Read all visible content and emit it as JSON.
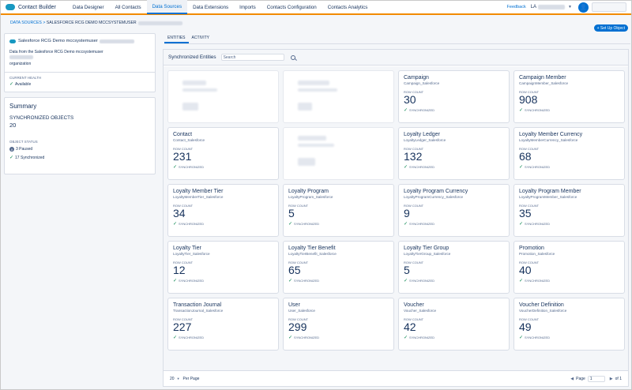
{
  "app": {
    "title": "Contact Builder",
    "brand_color": "#1798c1",
    "accent": "#f28b00"
  },
  "nav": [
    {
      "label": "Data Designer",
      "active": false
    },
    {
      "label": "All Contacts",
      "active": false
    },
    {
      "label": "Data Sources",
      "active": true
    },
    {
      "label": "Data Extensions",
      "active": false
    },
    {
      "label": "Imports",
      "active": false
    },
    {
      "label": "Contacts Configuration",
      "active": false
    },
    {
      "label": "Contacts Analytics",
      "active": false
    }
  ],
  "topright": {
    "feedback": "Feedback",
    "account": "LA",
    "caret": "▼",
    "avatar": "👤"
  },
  "breadcrumb": {
    "root": "DATA SOURCES",
    "sep": " > ",
    "current": "SALESFORCE RCG DEMO MCCSYSTEMUSER"
  },
  "setup_button": {
    "label": "+ Set Up Object"
  },
  "source": {
    "title": "Salesforce RCG Demo mccsystemuser",
    "description": "Data from the Salesforce RCG Demo mccsystemuser",
    "description_tail": "organization",
    "health_label": "CURRENT HEALTH",
    "health_value": "Available"
  },
  "summary": {
    "title": "Summary",
    "sync_label": "SYNCHRONIZED OBJECTS",
    "sync_value": "20",
    "status_label": "OBJECT STATUS",
    "paused": "3 Paused",
    "synced": "17 Synchronized"
  },
  "tabs": [
    {
      "label": "ENTITIES",
      "active": true
    },
    {
      "label": "ACTIVITY",
      "active": false
    }
  ],
  "entities": {
    "title": "Synchronized Entities",
    "search_placeholder": "Search"
  },
  "cards": [
    {
      "title": "Campaign",
      "api": "Campaign_Salesforce",
      "rc": "ROW COUNT",
      "count": "30",
      "sync": "SYNCHRONIZED"
    },
    {
      "title": "Campaign Member",
      "api": "CampaignMember_Salesforce",
      "rc": "ROW COUNT",
      "count": "908",
      "sync": "SYNCHRONIZED"
    },
    {
      "title": "Contact",
      "api": "Contact_Salesforce",
      "rc": "ROW COUNT",
      "count": "231",
      "sync": "SYNCHRONIZED"
    },
    {
      "title": "Loyalty Ledger",
      "api": "LoyaltyLedger_Salesforce",
      "rc": "ROW COUNT",
      "count": "132",
      "sync": "SYNCHRONIZED"
    },
    {
      "title": "Loyalty Member Currency",
      "api": "LoyaltyMemberCurrency_Salesforce",
      "rc": "ROW COUNT",
      "count": "68",
      "sync": "SYNCHRONIZED"
    },
    {
      "title": "Loyalty Member Tier",
      "api": "LoyaltyMemberTier_Salesforce",
      "rc": "ROW COUNT",
      "count": "34",
      "sync": "SYNCHRONIZED"
    },
    {
      "title": "Loyalty Program",
      "api": "LoyaltyProgram_Salesforce",
      "rc": "ROW COUNT",
      "count": "5",
      "sync": "SYNCHRONIZED"
    },
    {
      "title": "Loyalty Program Currency",
      "api": "LoyaltyProgramCurrency_Salesforce",
      "rc": "ROW COUNT",
      "count": "9",
      "sync": "SYNCHRONIZED"
    },
    {
      "title": "Loyalty Program Member",
      "api": "LoyaltyProgramMember_Salesforce",
      "rc": "ROW COUNT",
      "count": "35",
      "sync": "SYNCHRONIZED"
    },
    {
      "title": "Loyalty Tier",
      "api": "LoyaltyTier_Salesforce",
      "rc": "ROW COUNT",
      "count": "12",
      "sync": "SYNCHRONIZED"
    },
    {
      "title": "Loyalty Tier Benefit",
      "api": "LoyaltyTierBenefit_Salesforce",
      "rc": "ROW COUNT",
      "count": "65",
      "sync": "SYNCHRONIZED"
    },
    {
      "title": "Loyalty Tier Group",
      "api": "LoyaltyTierGroup_Salesforce",
      "rc": "ROW COUNT",
      "count": "5",
      "sync": "SYNCHRONIZED"
    },
    {
      "title": "Promotion",
      "api": "Promotion_Salesforce",
      "rc": "ROW COUNT",
      "count": "40",
      "sync": "SYNCHRONIZED"
    },
    {
      "title": "Transaction Journal",
      "api": "TransactionJournal_Salesforce",
      "rc": "ROW COUNT",
      "count": "227",
      "sync": "SYNCHRONIZED"
    },
    {
      "title": "User",
      "api": "User_Salesforce",
      "rc": "ROW COUNT",
      "count": "299",
      "sync": "SYNCHRONIZED"
    },
    {
      "title": "Voucher",
      "api": "Voucher_Salesforce",
      "rc": "ROW COUNT",
      "count": "42",
      "sync": "SYNCHRONIZED"
    },
    {
      "title": "Voucher Definition",
      "api": "VoucherDefinition_Salesforce",
      "rc": "ROW COUNT",
      "count": "49",
      "sync": "SYNCHRONIZED"
    }
  ],
  "footer": {
    "per_page_value": "20",
    "per_page_label": "Per Page",
    "page_label": "Page",
    "page_value": "1",
    "of_label": "of 1"
  }
}
